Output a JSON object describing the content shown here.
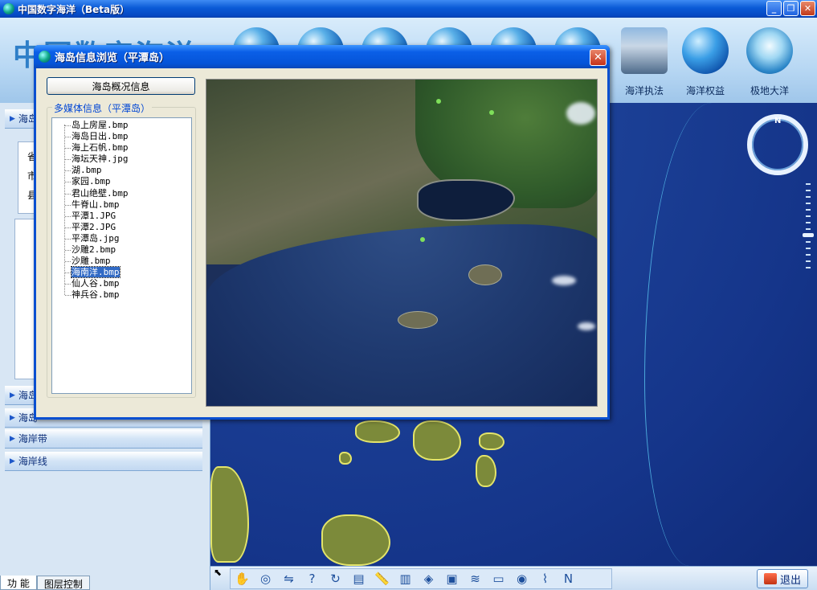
{
  "window": {
    "title": "中国数字海洋（Beta版）",
    "min_label": "_",
    "max_label": "❐",
    "close_label": "✕"
  },
  "header": {
    "logo_text": "中国数字海洋",
    "nav": [
      {
        "label": "海洋执法",
        "icon": "police-officers-icon"
      },
      {
        "label": "海洋权益",
        "icon": "ocean-globe-icon"
      },
      {
        "label": "极地大洋",
        "icon": "polar-globe-icon"
      }
    ]
  },
  "left_panel": {
    "rows": [
      "海岛",
      "海岛",
      "海岛",
      "海岸带",
      "海岸线"
    ],
    "labels": [
      "省",
      "市",
      "县"
    ],
    "tabs": [
      "功 能",
      "图层控制"
    ]
  },
  "dialog": {
    "title": "海岛信息浏览（平潭岛）",
    "close_label": "✕",
    "summary_button": "海岛概况信息",
    "group_label": "多媒体信息（平潭岛）",
    "files": [
      "岛上房屋.bmp",
      "海岛日出.bmp",
      "海上石帆.bmp",
      "海坛天神.jpg",
      "湖.bmp",
      "家园.bmp",
      "君山绝壁.bmp",
      "牛脊山.bmp",
      "平潭1.JPG",
      "平潭2.JPG",
      "平潭岛.jpg",
      "沙雕2.bmp",
      "沙雕.bmp",
      "海南洋.bmp",
      "仙人谷.bmp",
      "神兵谷.bmp"
    ],
    "selected_index": 13
  },
  "map": {
    "compass_label": "N"
  },
  "toolbar": {
    "icons": [
      "pan-hand-icon",
      "rotate-globe-icon",
      "tilt-icon",
      "query-icon",
      "refresh-icon",
      "layer-icon",
      "measure-icon",
      "building-icon",
      "locate-icon",
      "screenshot-icon",
      "terrain-icon",
      "scale-icon",
      "view-icon",
      "profile-icon",
      "north-icon"
    ],
    "exit_label": "退出",
    "corner_mark": "⬉"
  },
  "colors": {
    "xp_blue": "#0554d8",
    "selection": "#316ac5",
    "dialog_bg": "#ece9d8"
  }
}
